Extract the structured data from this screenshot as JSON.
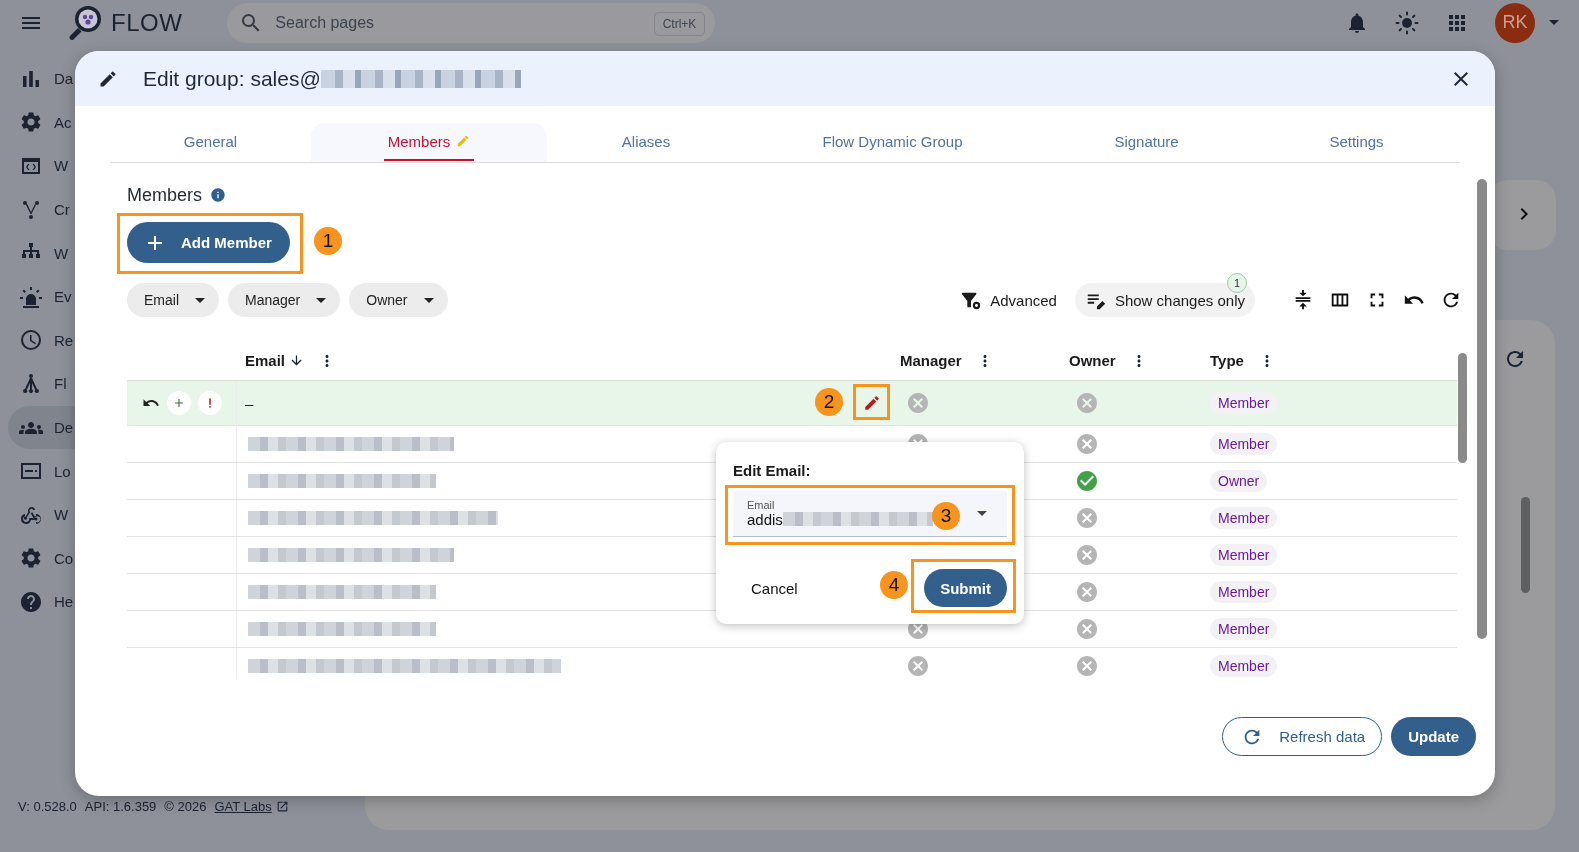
{
  "app": {
    "title": "FLOW",
    "search": {
      "placeholder": "Search pages",
      "shortcut": "Ctrl+K"
    },
    "avatar": "RK"
  },
  "sidebar": {
    "items": [
      {
        "label": "Da",
        "selected": false
      },
      {
        "label": "Ac",
        "selected": false
      },
      {
        "label": "W",
        "selected": false
      },
      {
        "label": "Cr",
        "selected": false
      },
      {
        "label": "W",
        "selected": false
      },
      {
        "label": "Ev",
        "selected": false
      },
      {
        "label": "Re",
        "selected": false
      },
      {
        "label": "Fl",
        "selected": false
      },
      {
        "label": "De",
        "selected": true
      },
      {
        "label": "Lo",
        "selected": false
      },
      {
        "label": "W",
        "selected": false
      },
      {
        "label": "Co",
        "selected": false
      },
      {
        "label": "He",
        "selected": false
      }
    ]
  },
  "footer": {
    "version": "V: 0.528.0",
    "api": "API: 1.6.359",
    "copyright": "© 2026",
    "link": "GAT Labs"
  },
  "dialog": {
    "title": "Edit group: sales@",
    "tabs": [
      {
        "label": "General",
        "selected": false,
        "edited": false
      },
      {
        "label": "Members",
        "selected": true,
        "edited": true
      },
      {
        "label": "Aliases",
        "selected": false,
        "edited": false
      },
      {
        "label": "Flow Dynamic Group",
        "selected": false,
        "edited": false
      },
      {
        "label": "Signature",
        "selected": false,
        "edited": false
      },
      {
        "label": "Settings",
        "selected": false,
        "edited": false
      }
    ],
    "section_title": "Members",
    "add_button": "Add Member",
    "filters": [
      {
        "label": "Email"
      },
      {
        "label": "Manager"
      },
      {
        "label": "Owner"
      }
    ],
    "advanced": "Advanced",
    "show_changes": {
      "label": "Show changes only",
      "count": "1"
    },
    "table": {
      "columns": [
        {
          "label": "Email",
          "sorted": true
        },
        {
          "label": "Manager",
          "sorted": false
        },
        {
          "label": "Owner",
          "sorted": false
        },
        {
          "label": "Type",
          "sorted": false
        }
      ],
      "rows": [
        {
          "kind": "new",
          "email": "–",
          "manager": false,
          "owner": false,
          "type": "Member"
        },
        {
          "kind": "existing",
          "manager": false,
          "owner": false,
          "type": "Member"
        },
        {
          "kind": "existing",
          "owner": true,
          "type": "Owner"
        },
        {
          "kind": "existing",
          "owner": false,
          "type": "Member"
        },
        {
          "kind": "existing",
          "owner": false,
          "type": "Member"
        },
        {
          "kind": "existing",
          "owner": false,
          "type": "Member"
        },
        {
          "kind": "existing",
          "manager": false,
          "owner": false,
          "type": "Member"
        },
        {
          "kind": "existing",
          "manager": false,
          "owner": false,
          "type": "Member"
        }
      ]
    },
    "popup": {
      "title": "Edit Email:",
      "field_label": "Email",
      "value": "addis",
      "cancel": "Cancel",
      "submit": "Submit"
    },
    "buttons": {
      "refresh": "Refresh data",
      "update": "Update"
    }
  },
  "annotations": [
    {
      "number": "1"
    },
    {
      "number": "2"
    },
    {
      "number": "3"
    },
    {
      "number": "4"
    }
  ]
}
